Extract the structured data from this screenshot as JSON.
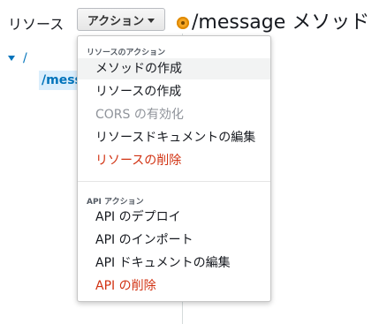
{
  "left_panel": {
    "title": "リソース",
    "actions_button": {
      "label": "アクション"
    },
    "tree": {
      "root": "/",
      "child": "/message"
    }
  },
  "right_panel": {
    "title": "/message メソッド",
    "status_color": "#f5a623"
  },
  "dropdown": {
    "resource_section": {
      "header": "リソースのアクション",
      "items": [
        {
          "label": "メソッドの作成"
        },
        {
          "label": "リソースの作成"
        },
        {
          "label": "CORS の有効化"
        },
        {
          "label": "リソースドキュメントの編集"
        },
        {
          "label": "リソースの削除"
        }
      ]
    },
    "api_section": {
      "header": "API アクション",
      "items": [
        {
          "label": "API のデプロイ"
        },
        {
          "label": "API のインポート"
        },
        {
          "label": "API ドキュメントの編集"
        },
        {
          "label": "API の削除"
        }
      ]
    }
  },
  "colors": {
    "danger": "#d13212",
    "link": "#0073bb",
    "disabled": "#8f939a"
  }
}
